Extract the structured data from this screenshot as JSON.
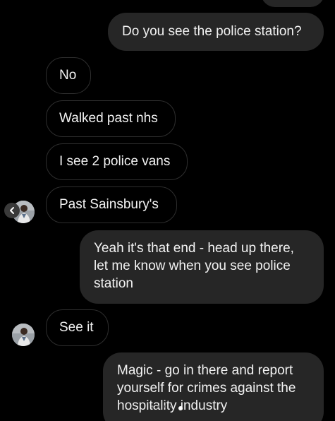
{
  "messages": [
    {
      "direction": "outgoing",
      "text": ""
    },
    {
      "direction": "outgoing",
      "text": "Do you see the police station?"
    },
    {
      "direction": "incoming",
      "text": "No"
    },
    {
      "direction": "incoming",
      "text": "Walked past nhs"
    },
    {
      "direction": "incoming",
      "text": "I see 2 police vans"
    },
    {
      "direction": "incoming",
      "text": "Past Sainsbury's"
    },
    {
      "direction": "outgoing",
      "lines": [
        "Yeah it's that end - head up there,",
        "let me know when you see police",
        "station"
      ]
    },
    {
      "direction": "incoming",
      "text": "See it"
    },
    {
      "direction": "outgoing",
      "lines": [
        "Magic - go in there and report",
        "yourself for crimes against the",
        "hospitality industry"
      ]
    }
  ],
  "typing_indicator": {
    "text": "• • • •"
  },
  "colors": {
    "background": "#000000",
    "outgoing_bubble": "#262626",
    "incoming_border": "#2e2e2e",
    "text": "#f2f2f2"
  },
  "icons": {
    "avatar": "contact-avatar-icon",
    "back": "chevron-left-icon"
  }
}
